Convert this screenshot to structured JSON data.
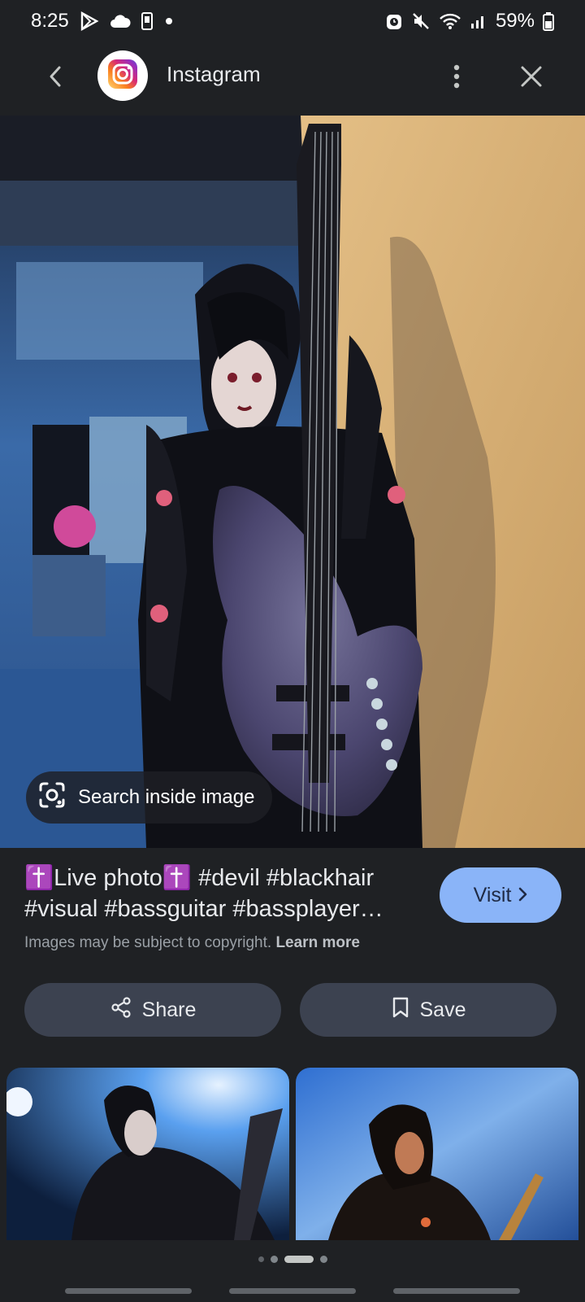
{
  "status_bar": {
    "time": "8:25",
    "battery": "59%",
    "icons": [
      "play-store-icon",
      "cloud-icon",
      "phone-icon",
      "dot-icon",
      "alarm-icon",
      "mute-icon",
      "wifi-icon",
      "signal-icon",
      "battery-icon"
    ]
  },
  "header": {
    "site_name": "Instagram",
    "logo_icon": "instagram-icon"
  },
  "hero": {
    "search_label": "Search inside image"
  },
  "result": {
    "title": "✝️Live photo✝️  #devil #blackhair #visual #bassguitar #bassplayer…",
    "copyright_text": "Images may be subject to copyright.",
    "learn_more": "Learn more",
    "visit_label": "Visit"
  },
  "actions": {
    "share_label": "Share",
    "save_label": "Save"
  },
  "carousel": {
    "page_count": 4,
    "active_index": 2
  },
  "colors": {
    "background": "#1f2124",
    "accent": "#8ab4f8",
    "chip": "#3c4250"
  }
}
